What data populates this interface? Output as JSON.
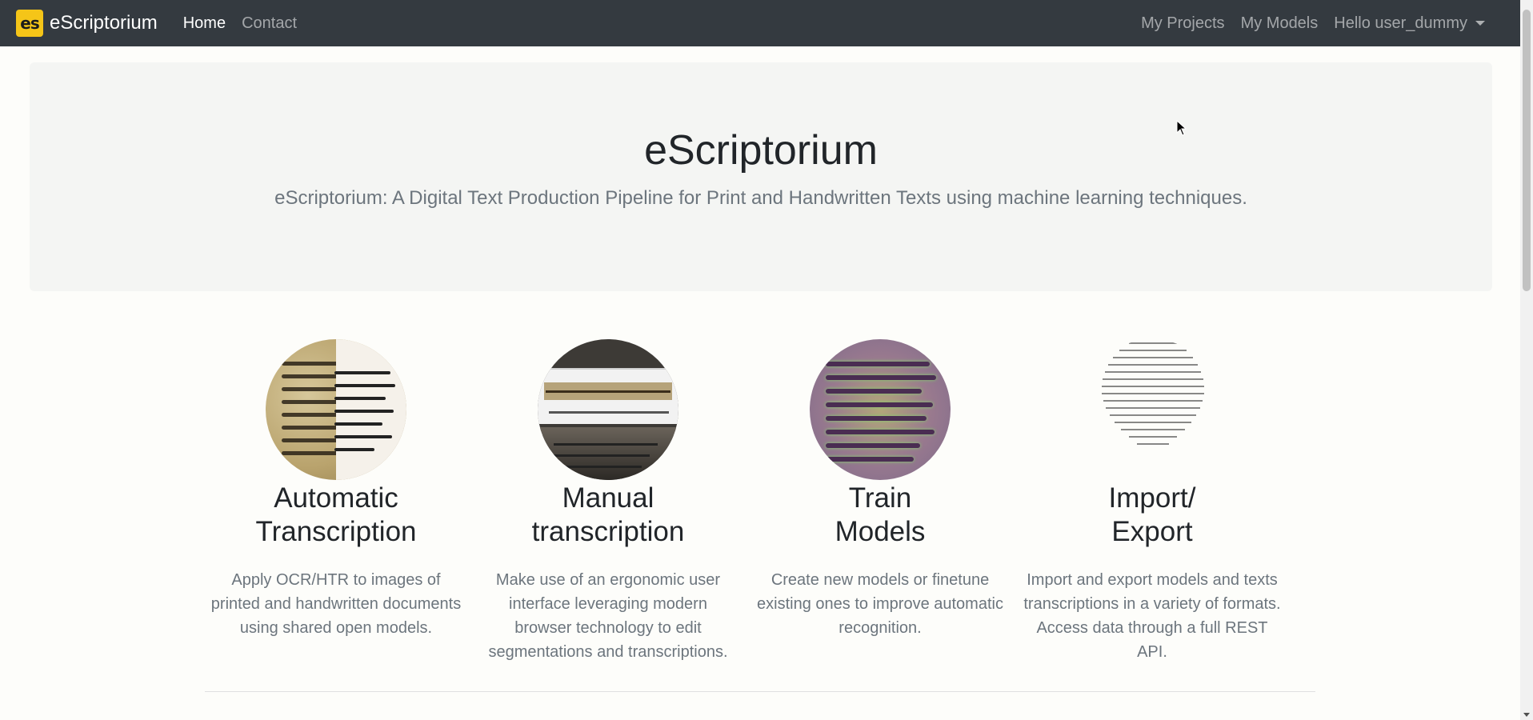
{
  "navbar": {
    "brand_logo_text": "es",
    "brand_name": "eScriptorium",
    "links": [
      {
        "label": "Home",
        "active": true
      },
      {
        "label": "Contact",
        "active": false
      }
    ],
    "right_links": [
      {
        "label": "My Projects"
      },
      {
        "label": "My Models"
      }
    ],
    "user_menu": {
      "label": "Hello user_dummy"
    }
  },
  "jumbotron": {
    "title": "eScriptorium",
    "lead": "eScriptorium: A Digital Text Production Pipeline for Print and Handwritten Texts using machine learning techniques."
  },
  "features": [
    {
      "title_line1": "Automatic",
      "title_line2": "Transcription",
      "text": "Apply OCR/HTR to images of printed and handwritten documents using shared open models.",
      "image": "manuscript-ocr-image"
    },
    {
      "title_line1": "Manual",
      "title_line2": "transcription",
      "text": "Make use of an ergonomic user interface leveraging modern browser technology to edit segmentations and transcriptions.",
      "image": "transcription-ui-image"
    },
    {
      "title_line1": "Train",
      "title_line2": "Models",
      "text": "Create new models or finetune existing ones to improve automatic recognition.",
      "image": "segmentation-heatmap-image"
    },
    {
      "title_line1": "Import/",
      "title_line2": "Export",
      "text": "Import and export models and texts transcriptions in a variety of formats. Access data through a full REST API.",
      "image": "exported-text-image"
    }
  ],
  "colors": {
    "navbar_bg": "#343a40",
    "brand_logo_bg": "#f5c518",
    "jumbotron_bg": "#f4f5f3",
    "muted_text": "#6c757d"
  }
}
